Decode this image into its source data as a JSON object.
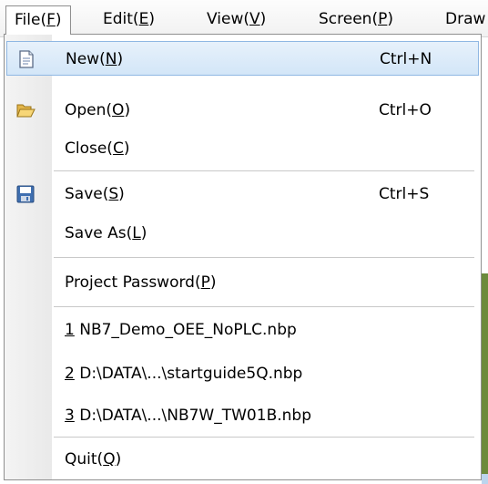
{
  "menubar": {
    "items": [
      {
        "pre": "File(",
        "key": "F",
        "post": ")"
      },
      {
        "pre": "Edit(",
        "key": "E",
        "post": ")"
      },
      {
        "pre": "View(",
        "key": "V",
        "post": ")"
      },
      {
        "pre": "Screen(",
        "key": "P",
        "post": ")"
      },
      {
        "pre": "Draw",
        "key": "",
        "post": ""
      }
    ]
  },
  "file_menu": {
    "new": {
      "pre": "New(",
      "key": "N",
      "post": ")",
      "shortcut": "Ctrl+N",
      "icon": "new-file-icon"
    },
    "open": {
      "pre": "Open(",
      "key": "O",
      "post": ")",
      "shortcut": "Ctrl+O",
      "icon": "open-folder-icon"
    },
    "close": {
      "pre": "Close(",
      "key": "C",
      "post": ")"
    },
    "save": {
      "pre": "Save(",
      "key": "S",
      "post": ")",
      "shortcut": "Ctrl+S",
      "icon": "save-disk-icon"
    },
    "save_as": {
      "pre": "Save As(",
      "key": "L",
      "post": ")"
    },
    "password": {
      "pre": "Project Password(",
      "key": "P",
      "post": ")"
    },
    "recent": [
      {
        "num": "1",
        "name": " NB7_Demo_OEE_NoPLC.nbp"
      },
      {
        "num": "2",
        "name": " D:\\DATA\\...\\startguide5Q.nbp"
      },
      {
        "num": "3",
        "name": " D:\\DATA\\...\\NB7W_TW01B.nbp"
      }
    ],
    "quit": {
      "pre": "Quit(",
      "key": "Q",
      "post": ")"
    }
  }
}
